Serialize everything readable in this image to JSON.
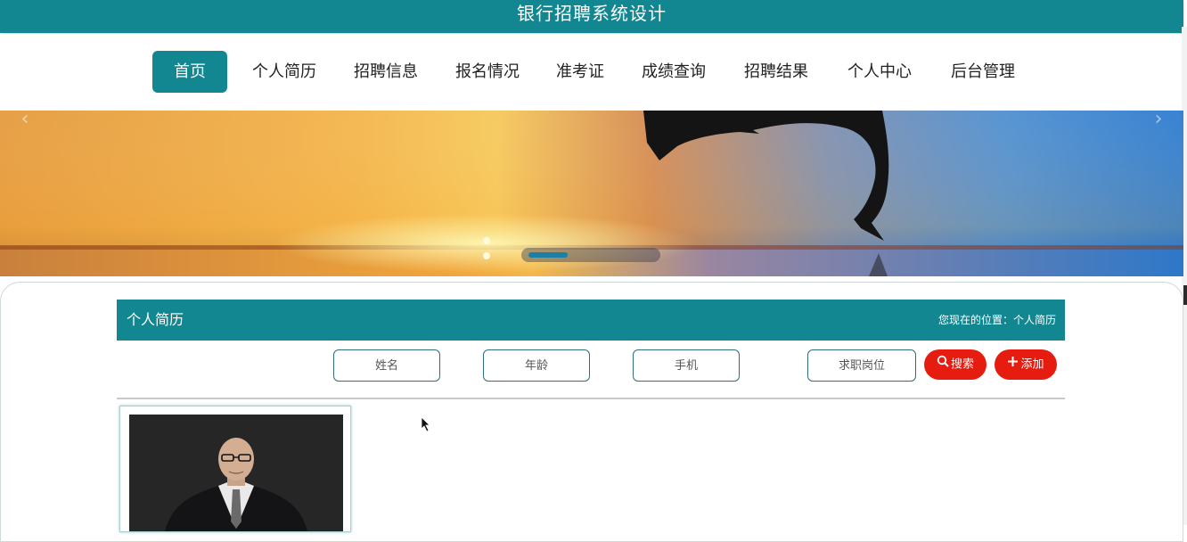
{
  "app": {
    "title": "银行招聘系统设计"
  },
  "nav": {
    "items": [
      {
        "label": "首页",
        "active": true
      },
      {
        "label": "个人简历"
      },
      {
        "label": "招聘信息"
      },
      {
        "label": "报名情况"
      },
      {
        "label": "准考证"
      },
      {
        "label": "成绩查询"
      },
      {
        "label": "招聘结果"
      },
      {
        "label": "个人中心"
      },
      {
        "label": "后台管理"
      }
    ]
  },
  "banner": {
    "prev_icon": "chevron-left-icon",
    "next_icon": "chevron-right-icon",
    "slide_count": 3,
    "active_slide": 1
  },
  "section": {
    "title": "个人简历",
    "breadcrumb_prefix": "您现在的位置：",
    "breadcrumb_current": "个人简历"
  },
  "search": {
    "name_placeholder": "姓名",
    "age_placeholder": "年龄",
    "phone_placeholder": "手机",
    "position_placeholder": "求职岗位",
    "search_label": "搜索",
    "search_icon": "search-icon",
    "add_label": "添加",
    "add_icon": "plus-icon"
  },
  "colors": {
    "primary": "#138791",
    "danger": "#e51c0f"
  }
}
